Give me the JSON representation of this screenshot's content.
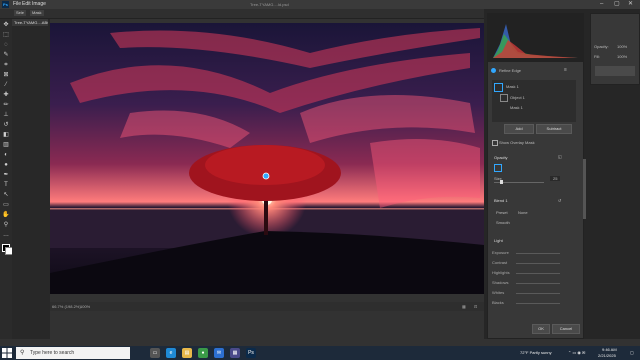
{
  "app": {
    "menu": [
      "File",
      "Edit",
      "Image"
    ],
    "window_title": "Tree-TYAMG....Id.psd",
    "logo_text": "Ps"
  },
  "options_bar": {
    "doc_tab": "Tree-TYAMG....ABC",
    "buttons": [
      "Sele",
      "Mask",
      "Ref"
    ]
  },
  "status_bar": {
    "zoom": "66.7% (198.2%)",
    "info": "100%"
  },
  "properties": {
    "title": "Refine Edge",
    "layer_items": [
      "Mask 1",
      "Object 1",
      "Mask 1"
    ],
    "buttons": [
      "Add",
      "Subtract"
    ],
    "checkbox_label": "Show Overlay Mask",
    "section_opacity": "Opacity",
    "size_label": "Size",
    "size_value": "25",
    "blend_section": "Blend 1",
    "blend_fields": [
      {
        "label": "Preset",
        "value": "None"
      },
      {
        "label": "Smooth",
        "value": "0"
      }
    ],
    "light_section": "Light",
    "light_fields": [
      "Exposure",
      "Contrast",
      "Highlights",
      "Shadows",
      "Whites",
      "Blacks"
    ],
    "ok": "OK",
    "cancel": "Cancel"
  },
  "right_top": {
    "label1": "Opacity:",
    "value1": "100%",
    "label2": "Fill:",
    "value2": "100%"
  },
  "taskbar": {
    "search_placeholder": "Type here to search",
    "weather": "72°F  Partly sunny",
    "time": "9:46 AM",
    "date": "2/21/2025",
    "app_icons": [
      {
        "name": "task-view-icon",
        "color": "#555",
        "glyph": "▭"
      },
      {
        "name": "edge-icon",
        "color": "#1f8ad6",
        "glyph": "e"
      },
      {
        "name": "explorer-icon",
        "color": "#e8b84a",
        "glyph": "▤"
      },
      {
        "name": "chrome-icon",
        "color": "#3a9a48",
        "glyph": "●"
      },
      {
        "name": "mail-icon",
        "color": "#2c6fd1",
        "glyph": "✉"
      },
      {
        "name": "store-icon",
        "color": "#4a4a8a",
        "glyph": "▦"
      },
      {
        "name": "photoshop-icon",
        "color": "#0b2a4a",
        "glyph": "Ps"
      }
    ]
  },
  "colors": {
    "accent": "#31a8ff",
    "canvas_sky_top": "#1e1740",
    "canvas_glow": "#ff5a6a"
  }
}
